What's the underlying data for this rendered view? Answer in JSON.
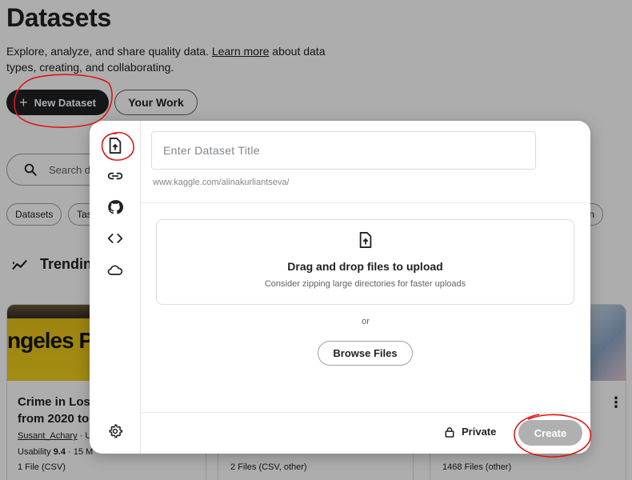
{
  "page": {
    "title": "Datasets",
    "description_before": "Explore, analyze, and share quality data. ",
    "description_link": "Learn more",
    "description_after": " about data types, creating, and collaborating.",
    "new_dataset_label": "New Dataset",
    "your_work_label": "Your Work",
    "search_placeholder": "Search da",
    "chips": [
      "Datasets",
      "Tas",
      "n"
    ],
    "trending_label": "Trendin",
    "cards": [
      {
        "title": "Crime in Los A from 2020 to",
        "author": "Susant_Achary",
        "usability_label": "Usability",
        "usability_value": "9.4",
        "size": "15 M",
        "files": "1 File (CSV)",
        "image_text": "ngeles Pol lice Line"
      },
      {
        "files": "2 Files (CSV, other)"
      },
      {
        "files": "1468 Files (other)"
      }
    ]
  },
  "modal": {
    "title_placeholder": "Enter Dataset Title",
    "url_hint": "www.kaggle.com/alinakurliantseva/",
    "drop_title": "Drag and drop files to upload",
    "drop_subtitle": "Consider zipping large directories for faster uploads",
    "or_label": "or",
    "browse_label": "Browse Files",
    "private_label": "Private",
    "create_label": "Create",
    "sidebar_icons": [
      "file-upload-icon",
      "link-icon",
      "github-icon",
      "code-icon",
      "cloud-icon",
      "settings-icon"
    ]
  },
  "colors": {
    "annotation": "#e01515",
    "primary_dark": "#202124",
    "create_disabled": "#b0b0b0"
  }
}
